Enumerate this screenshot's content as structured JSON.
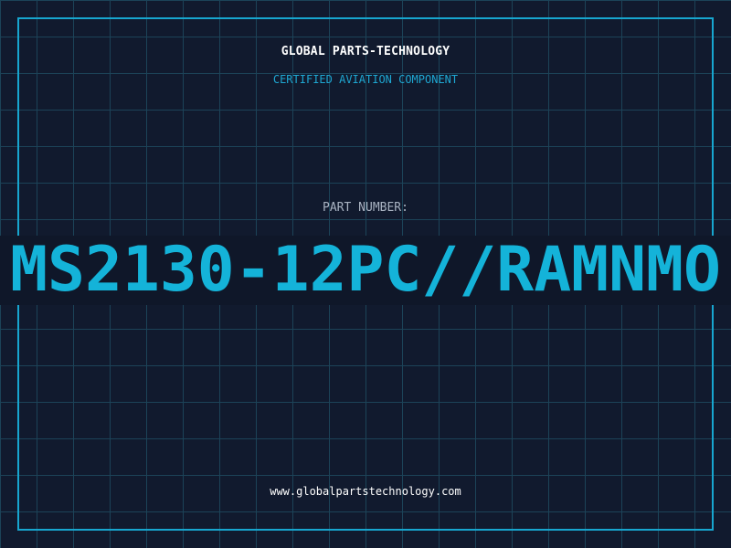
{
  "header": {
    "company": "GLOBAL PARTS-TECHNOLOGY",
    "tagline": "CERTIFIED AVIATION COMPONENT"
  },
  "part": {
    "label": "PART NUMBER:",
    "number": "MS2130-12PC//RAMNMO"
  },
  "footer": {
    "url": "www.globalpartstechnology.com"
  },
  "colors": {
    "background": "#111a2e",
    "grid": "#1c4358",
    "accent": "#17a6cf",
    "text": "#ffffff",
    "muted": "#a9b3c2"
  }
}
